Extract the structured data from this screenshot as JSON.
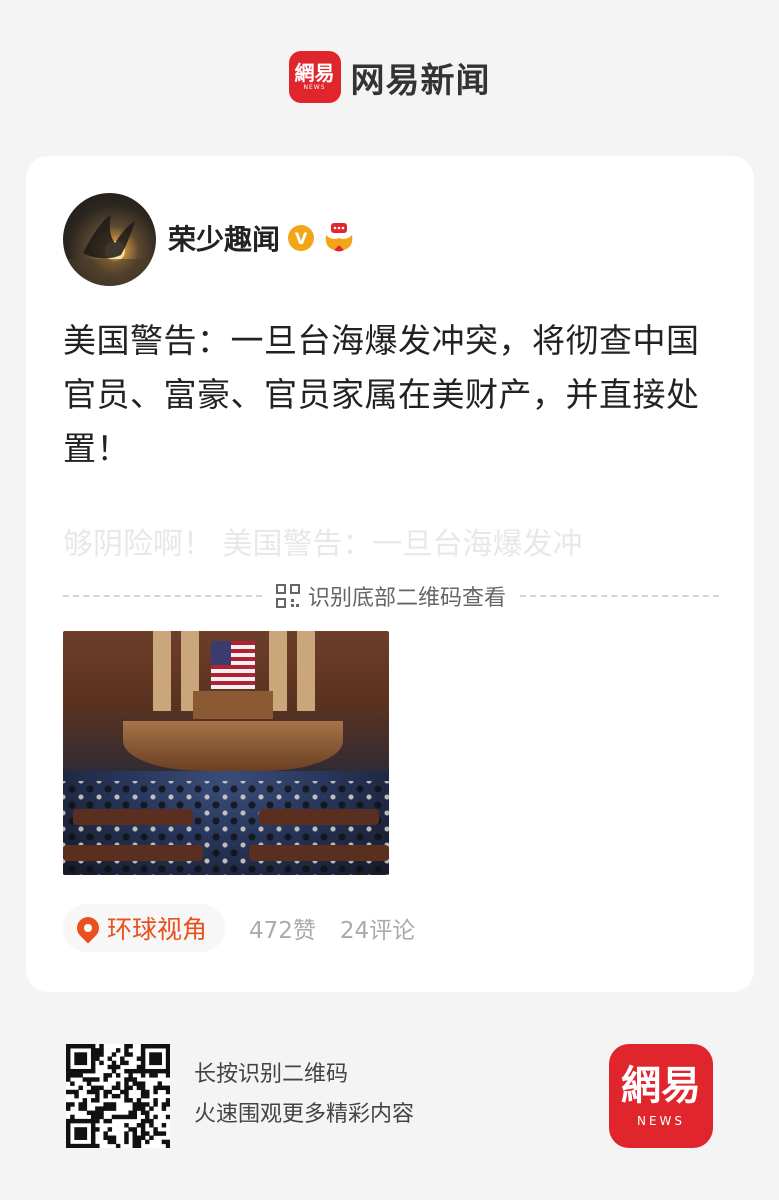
{
  "header": {
    "logo_glyph": "網易",
    "logo_news": "NEWS",
    "title": "网易新闻"
  },
  "post": {
    "author": "荣少趣闻",
    "verified_icon": "verified-badge-icon",
    "headline": "美国警告：一旦台海爆发冲突，将彻查中国官员、富豪、官员家属在美财产，并直接处置！",
    "preview": "够阴险啊！ 美国警告：一旦台海爆发冲",
    "qr_hint": "识别底部二维码查看",
    "tag": "环球视角",
    "likes": "472赞",
    "comments": "24评论"
  },
  "footer": {
    "line1": "长按识别二维码",
    "line2": "火速围观更多精彩内容",
    "logo_glyph": "網易",
    "logo_news": "NEWS"
  },
  "colors": {
    "brand_red": "#e0252d",
    "tag_orange": "#e8511c",
    "verify_gold": "#f2a516"
  }
}
